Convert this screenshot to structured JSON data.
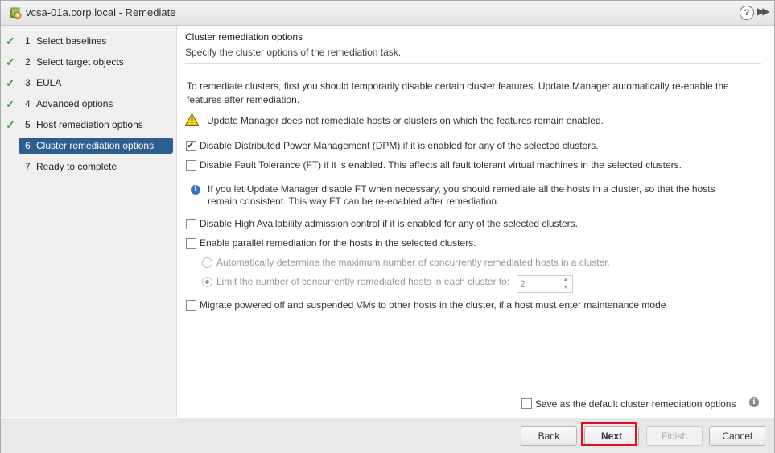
{
  "window": {
    "title": "vcsa-01a.corp.local - Remediate",
    "help_label": "?",
    "expand_label": "▶▶"
  },
  "steps": [
    {
      "num": "1",
      "label": "Select baselines",
      "done": true
    },
    {
      "num": "2",
      "label": "Select target objects",
      "done": true
    },
    {
      "num": "3",
      "label": "EULA",
      "done": true
    },
    {
      "num": "4",
      "label": "Advanced options",
      "done": true
    },
    {
      "num": "5",
      "label": "Host remediation options",
      "done": true
    },
    {
      "num": "6",
      "label": "Cluster remediation options",
      "done": false,
      "active": true
    },
    {
      "num": "7",
      "label": "Ready to complete",
      "done": false
    }
  ],
  "main": {
    "title": "Cluster remediation options",
    "subtitle": "Specify the cluster options of the remediation task.",
    "intro": "To remediate clusters, first you should temporarily disable certain cluster features. Update Manager automatically re-enable the features after remediation.",
    "warning": "Update Manager does not remediate hosts or clusters on which the features remain enabled.",
    "options": {
      "dpm": {
        "label": "Disable Distributed Power Management (DPM) if it is enabled for any of the selected clusters.",
        "checked": true
      },
      "ft": {
        "label": "Disable Fault Tolerance (FT) if it is enabled. This affects all fault tolerant virtual machines in the selected clusters.",
        "checked": false
      },
      "ft_info": "If you let Update Manager disable FT when necessary, you should remediate all the hosts in a cluster, so that the hosts remain consistent. This way FT can be re-enabled after remediation.",
      "ha": {
        "label": "Disable High Availability admission control if it is enabled for any of the selected clusters.",
        "checked": false
      },
      "parallel": {
        "label": "Enable parallel remediation for the hosts in the selected clusters.",
        "checked": false
      },
      "auto_radio": "Automatically determine the maximum number of concurrently remediated hosts in a cluster.",
      "limit_radio": "Limit the number of concurrently remediated hosts in each cluster to:",
      "limit_value": "2",
      "migrate": {
        "label": "Migrate powered off and suspended VMs to other hosts in the cluster, if a host must enter maintenance mode",
        "checked": false
      }
    },
    "save_default": "Save as the default cluster remediation options"
  },
  "footer": {
    "back": "Back",
    "next": "Next",
    "finish": "Finish",
    "cancel": "Cancel"
  },
  "colors": {
    "active_step": "#2e5d8f",
    "check": "#3a9a3a",
    "highlight": "#e0141e",
    "info": "#3375c2"
  }
}
